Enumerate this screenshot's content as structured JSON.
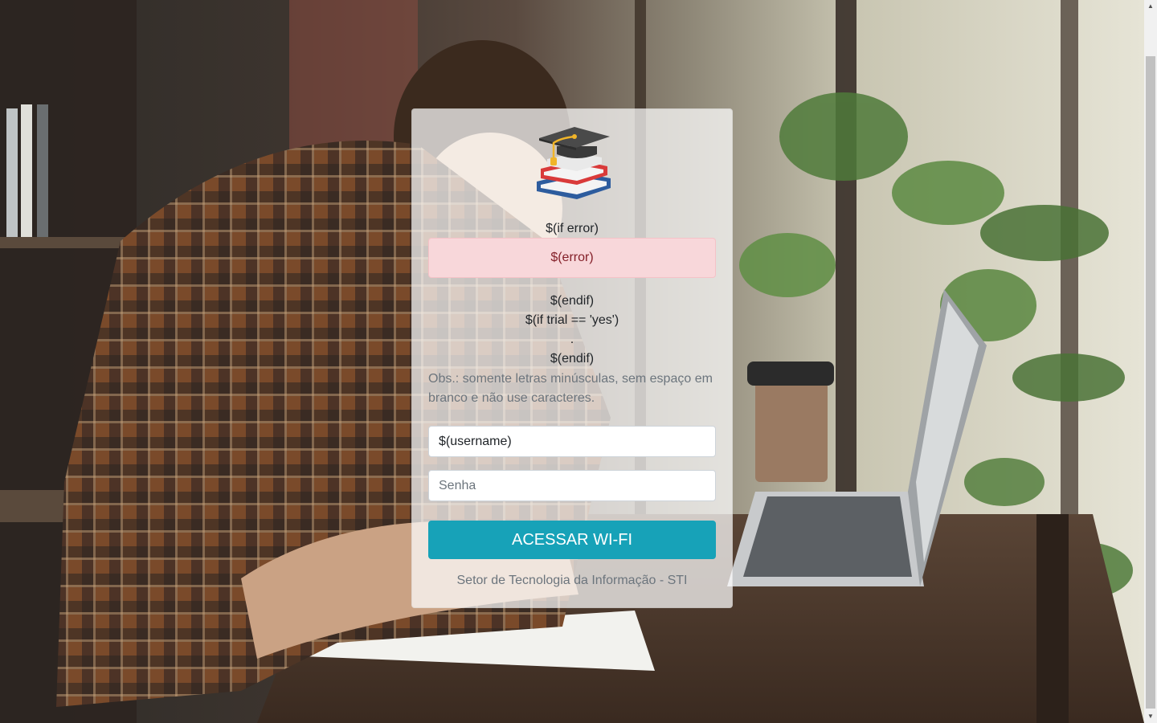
{
  "background": {
    "description_icon": "student-laptop-photo"
  },
  "card": {
    "logo_icon": "graduation-cap-books-icon",
    "if_error": "$(if error)",
    "error_message": "$(error)",
    "endif_1": "$(endif)",
    "if_trial": "$(if trial == 'yes')",
    "trial_dot": ".",
    "endif_2": "$(endif)",
    "obs_text": "Obs.: somente letras minúsculas, sem espaço em branco e não use caracteres.",
    "username_value": "$(username)",
    "password_placeholder": "Senha",
    "submit_label": "ACESSAR WI-FI",
    "footer_text": "Setor de Tecnologia da Informação - STI"
  },
  "colors": {
    "button": "#17a2b8",
    "alert_bg": "#f8d7da",
    "alert_text": "#842029"
  }
}
